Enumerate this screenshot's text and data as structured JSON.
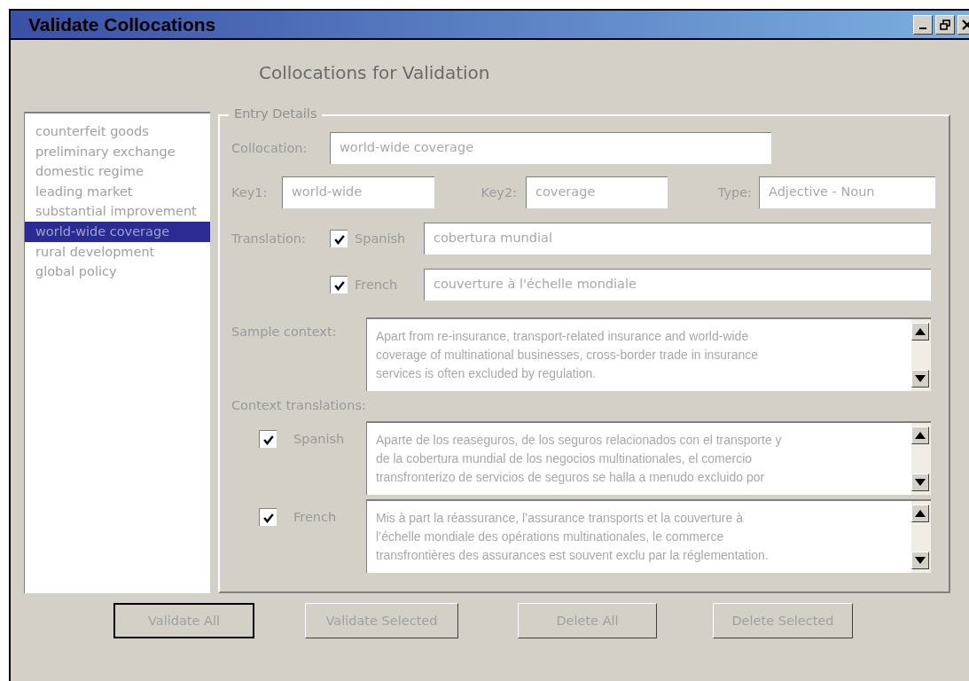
{
  "window": {
    "title": "Validate Collocations"
  },
  "heading": "Collocations for Validation",
  "collocations": [
    {
      "label": "counterfeit goods",
      "selected": false
    },
    {
      "label": "preliminary exchange",
      "selected": false
    },
    {
      "label": "domestic regime",
      "selected": false
    },
    {
      "label": "leading market",
      "selected": false
    },
    {
      "label": "substantial improvement",
      "selected": false
    },
    {
      "label": "world-wide coverage",
      "selected": true
    },
    {
      "label": "rural development",
      "selected": false
    },
    {
      "label": "global policy",
      "selected": false
    }
  ],
  "entry_details": {
    "title": "Entry Details",
    "collocation": {
      "label": "Collocation:",
      "value": "world-wide coverage"
    },
    "key1": {
      "label": "Key1:",
      "value": "world-wide"
    },
    "key2": {
      "label": "Key2:",
      "value": "coverage"
    },
    "type": {
      "label": "Type:",
      "value": "Adjective - Noun"
    },
    "translation_label": "Translation:",
    "translations": [
      {
        "language": "Spanish",
        "checked": true,
        "value": "cobertura mundial"
      },
      {
        "language": "French",
        "checked": true,
        "value": "couverture à l'échelle mondiale"
      }
    ],
    "sample_context": {
      "label": "Sample context:",
      "text": "Apart from re-insurance, transport-related insurance and world-wide\ncoverage of multinational businesses, cross-border trade in insurance\nservices is often excluded by regulation."
    },
    "context_translations_label": "Context translations:",
    "context_translations": [
      {
        "language": "Spanish",
        "checked": true,
        "text": "Aparte de los reaseguros, de los seguros relacionados con el transporte y\nde la cobertura mundial de los negocios multinationales, el comercio\ntransfronterizo de servicios de seguros se halla a menudo excluido por"
      },
      {
        "language": "French",
        "checked": true,
        "text": "Mis à part la réassurance, l’assurance transports et la couverture à\nl’échelle mondiale des opérations multinationales, le commerce\ntransfrontières des assurances est souvent exclu par la réglementation."
      }
    ]
  },
  "buttons": [
    {
      "label": "Validate All",
      "focused": true
    },
    {
      "label": "Validate Selected",
      "focused": false
    },
    {
      "label": "Delete All",
      "focused": false
    },
    {
      "label": "Delete Selected",
      "focused": false
    }
  ]
}
